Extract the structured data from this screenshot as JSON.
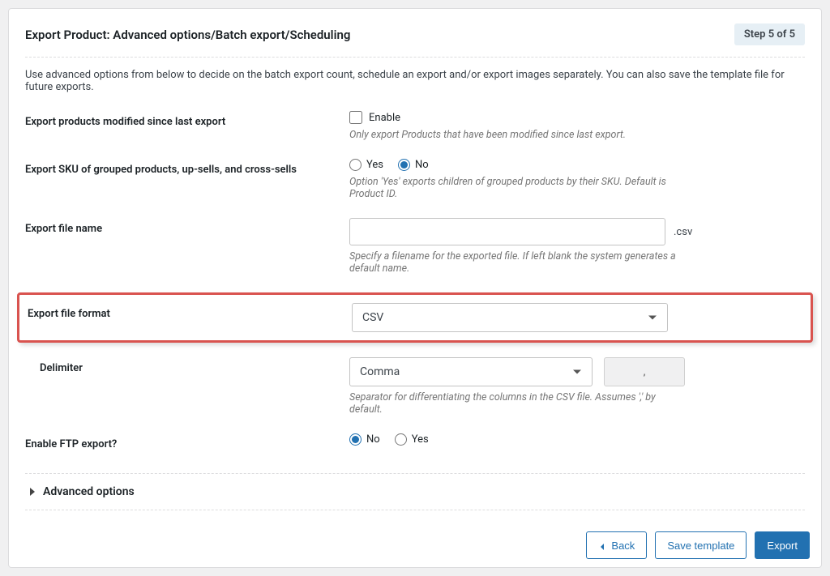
{
  "header": {
    "title": "Export Product: Advanced options/Batch export/Scheduling",
    "step": "Step 5 of 5"
  },
  "intro": "Use advanced options from below to decide on the batch export count, schedule an export and/or export images separately. You can also save the template file for future exports.",
  "fields": {
    "modified": {
      "label": "Export products modified since last export",
      "enable": "Enable",
      "helper": "Only export Products that have been modified since last export."
    },
    "sku": {
      "label": "Export SKU of grouped products, up-sells, and cross-sells",
      "yes": "Yes",
      "no": "No",
      "helper": "Option 'Yes' exports children of grouped products by their SKU. Default is Product ID."
    },
    "filename": {
      "label": "Export file name",
      "ext": ".csv",
      "helper": "Specify a filename for the exported file. If left blank the system generates a default name."
    },
    "format": {
      "label": "Export file format",
      "value": "CSV"
    },
    "delimiter": {
      "label": "Delimiter",
      "value": "Comma",
      "char": ",",
      "helper": "Separator for differentiating the columns in the CSV file. Assumes ',' by default."
    },
    "ftp": {
      "label": "Enable FTP export?",
      "no": "No",
      "yes": "Yes"
    },
    "advanced": "Advanced options"
  },
  "footer": {
    "back": "Back",
    "save": "Save template",
    "export": "Export"
  }
}
